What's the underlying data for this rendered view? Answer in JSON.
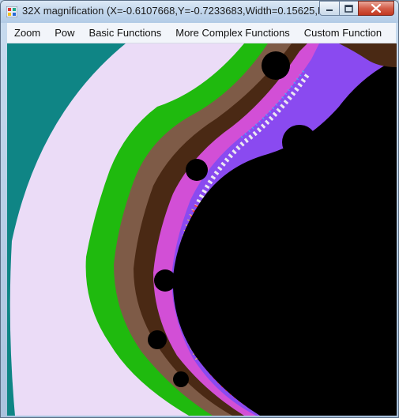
{
  "window": {
    "title": "32X magnification (X=-0.6107668,Y=-0.7233683,Width=0.15625,Hei..."
  },
  "menu": {
    "items": [
      {
        "label": "Zoom"
      },
      {
        "label": "Pow"
      },
      {
        "label": "Basic Functions"
      },
      {
        "label": "More Complex Functions"
      },
      {
        "label": "Custom Function"
      }
    ]
  },
  "fractal": {
    "colors": {
      "outer": "#0f8585",
      "lavender": "#ebdcf7",
      "green": "#1fba0e",
      "brown": "#7e5b47",
      "dark_brown": "#4a2914",
      "magenta": "#d24fd6",
      "purple": "#8a4af0",
      "interior": "#000000"
    }
  },
  "icons": {
    "app": "app-window-icon",
    "minimize": "minimize-icon",
    "maximize": "maximize-icon",
    "close": "close-icon"
  }
}
